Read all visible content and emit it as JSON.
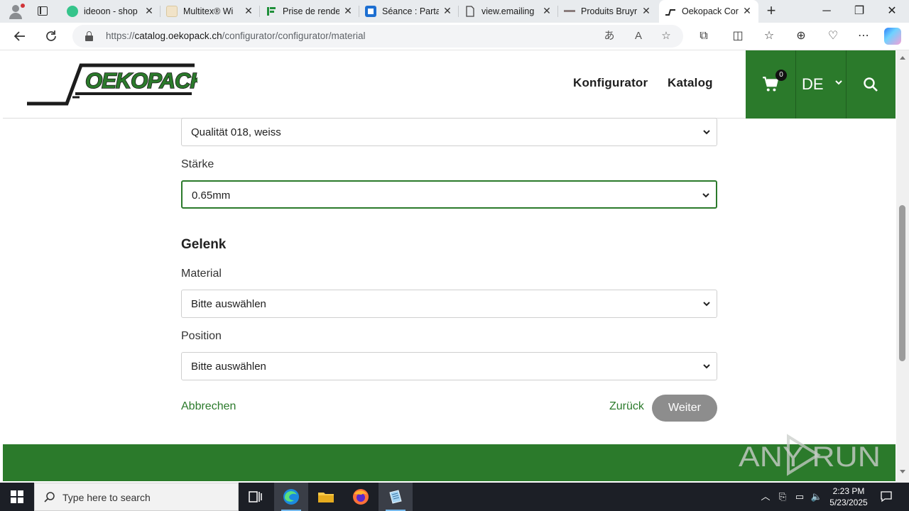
{
  "browser": {
    "tabs": [
      {
        "label": "ideoon - shop",
        "icon": "ideoon-favicon"
      },
      {
        "label": "Multitex® Wi",
        "icon": "multitex-favicon"
      },
      {
        "label": "Prise de rende",
        "icon": "prise-favicon"
      },
      {
        "label": "Séance : Parta",
        "icon": "seance-favicon"
      },
      {
        "label": "view.emailing",
        "icon": "document-icon"
      },
      {
        "label": "Produits Bruyr",
        "icon": "produits-favicon"
      },
      {
        "label": "Oekopack Cor",
        "icon": "oekopack-favicon",
        "active": true
      }
    ],
    "url": {
      "prefix": "https://",
      "domain": "catalog.oekopack.ch",
      "path": "/configurator/configurator/material"
    }
  },
  "site": {
    "logo_text": "OEKOPACK",
    "nav": {
      "konfigurator": "Konfigurator",
      "katalog": "Katalog"
    },
    "cart_count": "0",
    "language": "DE",
    "brand_color": "#2b7a2b"
  },
  "form": {
    "quality_value": "Qualität 018, weiss",
    "staerke_label": "Stärke",
    "staerke_value": "0.65mm",
    "gelenk_title": "Gelenk",
    "material_label": "Material",
    "material_value": "Bitte auswählen",
    "position_label": "Position",
    "position_value": "Bitte auswählen",
    "cancel": "Abbrechen",
    "back": "Zurück",
    "next": "Weiter"
  },
  "watermark": "ANY RUN",
  "taskbar": {
    "search_placeholder": "Type here to search",
    "time": "2:23 PM",
    "date": "5/23/2025"
  }
}
